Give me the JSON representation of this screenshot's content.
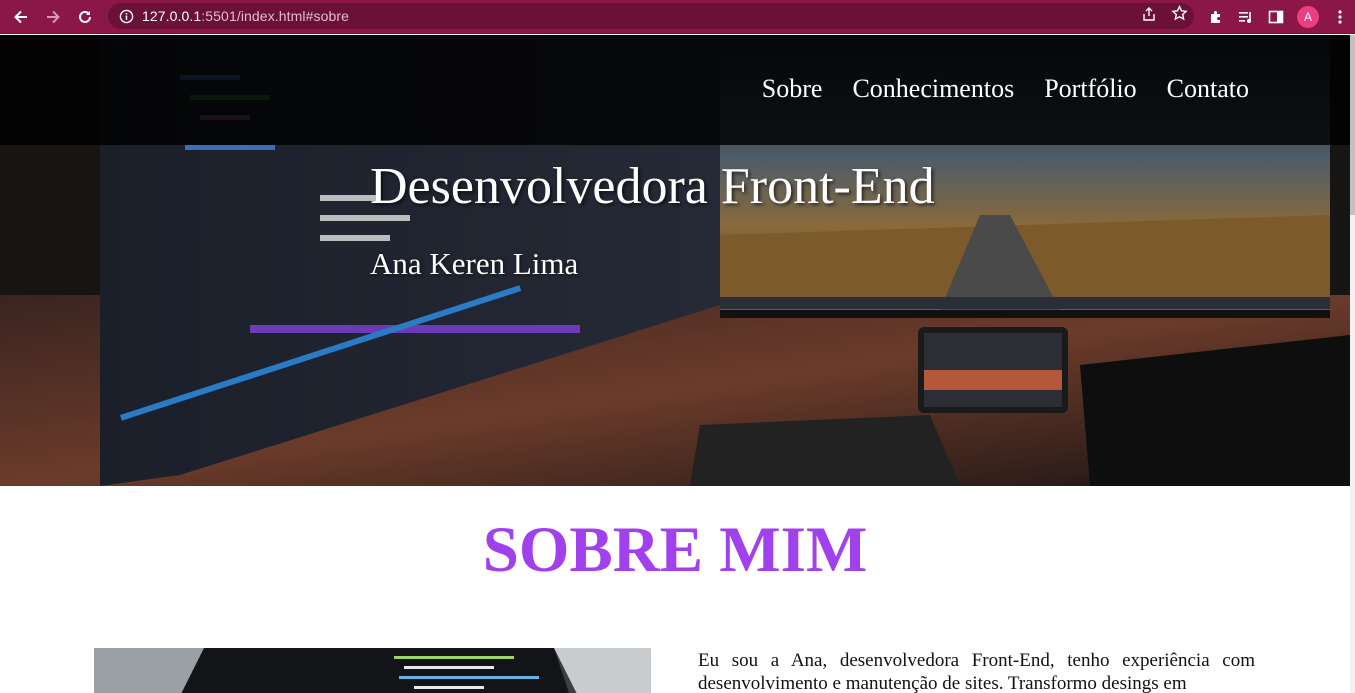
{
  "browser": {
    "url_host": "127.0.0.1",
    "url_path": ":5501/index.html#sobre",
    "avatar_letter": "A",
    "icons": [
      "back-icon",
      "forward-icon",
      "reload-icon",
      "info-icon",
      "share-icon",
      "star-icon",
      "extensions-icon",
      "media-icon",
      "side-panel-icon",
      "menu-icon"
    ],
    "accent": "#8a1747"
  },
  "nav": {
    "links": [
      "Sobre",
      "Conhecimentos",
      "Portfólio",
      "Contato"
    ]
  },
  "hero": {
    "title": "Desenvolvedora Front-End",
    "subtitle": "Ana Keren Lima"
  },
  "sobre": {
    "title": "SOBRE MIM",
    "title_color": "#a141ee",
    "text": "Eu sou a Ana, desenvolvedora Front-End, tenho experiência com desenvolvimento e manutenção de sites. Transformo desings em"
  }
}
